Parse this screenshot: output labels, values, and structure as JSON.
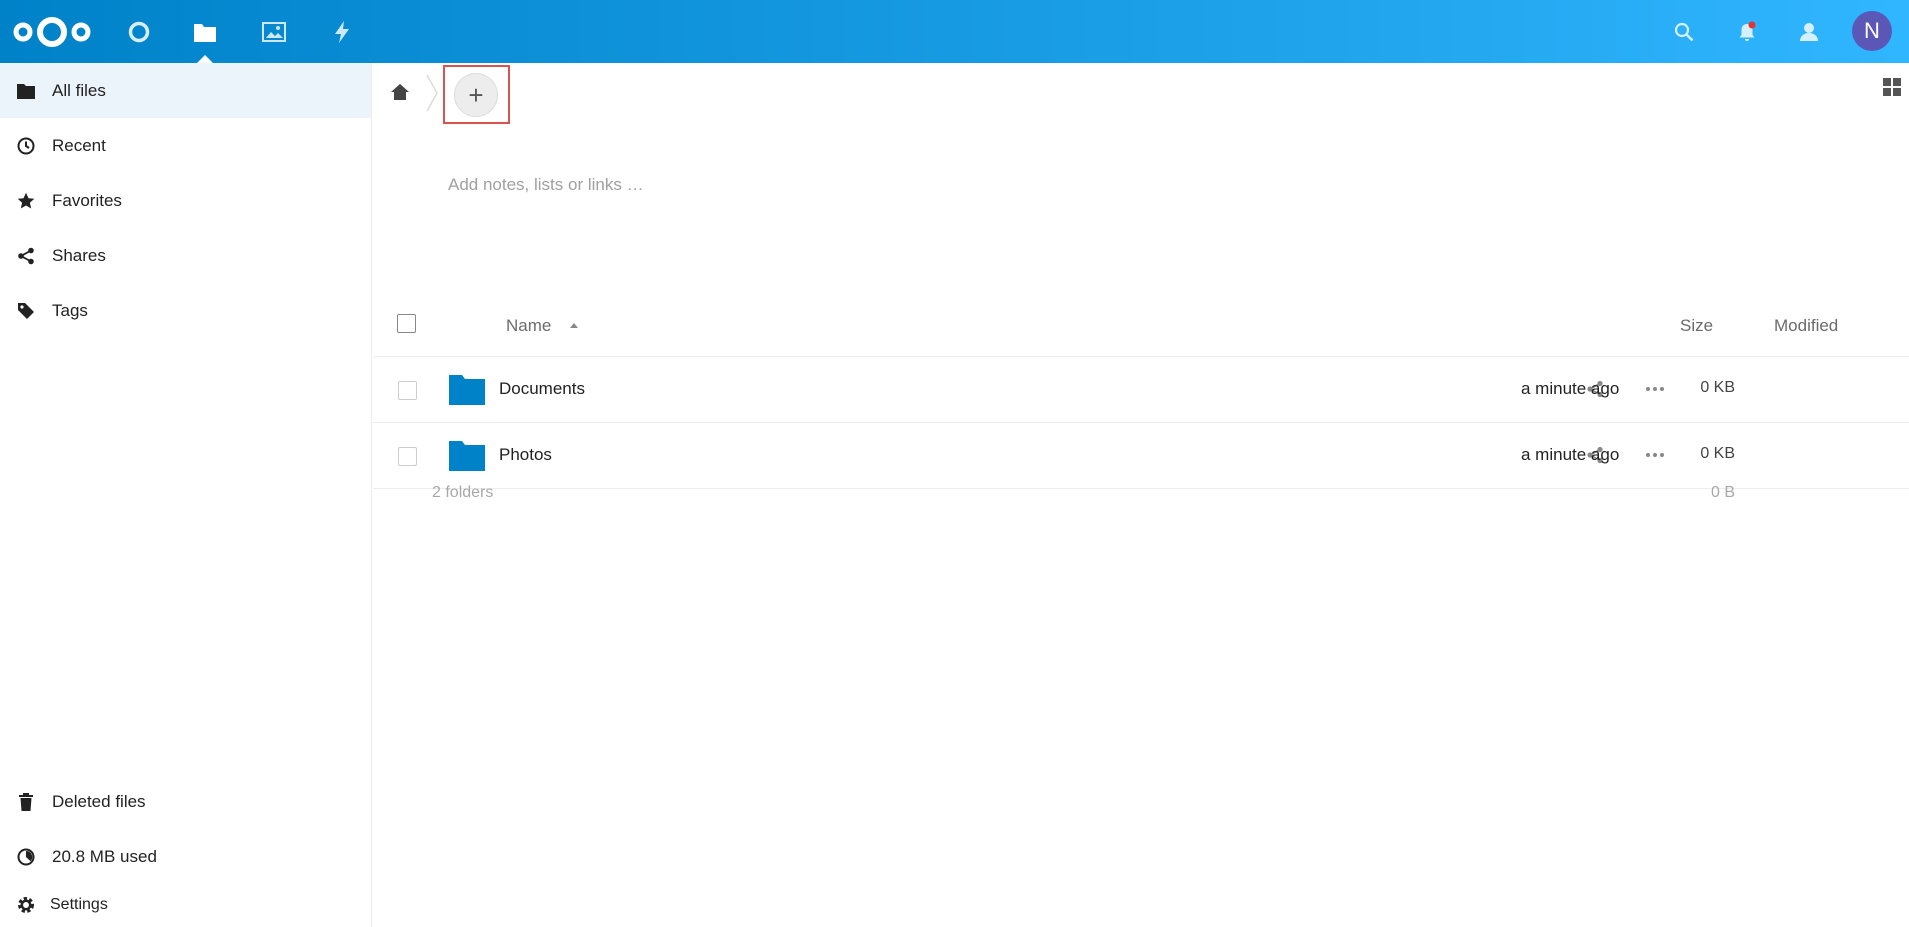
{
  "colors": {
    "header_start": "#0082c9",
    "header_end": "#30b6ff",
    "avatar": "#5b57b7",
    "folder": "#0082c9",
    "highlight_border": "#d9534f",
    "notification_dot": "#e9322d"
  },
  "header": {
    "logo_icon": "nextcloud-logo",
    "apps": [
      {
        "name": "dashboard-icon"
      },
      {
        "name": "files-icon",
        "active": true
      },
      {
        "name": "photos-icon"
      },
      {
        "name": "activity-icon"
      }
    ],
    "right_icons": [
      "search-icon",
      "notifications-icon",
      "contacts-icon"
    ],
    "avatar_letter": "N"
  },
  "sidebar": {
    "items": [
      {
        "label": "All files",
        "icon": "folder-icon",
        "active": true
      },
      {
        "label": "Recent",
        "icon": "clock-icon"
      },
      {
        "label": "Favorites",
        "icon": "star-icon"
      },
      {
        "label": "Shares",
        "icon": "share-icon"
      },
      {
        "label": "Tags",
        "icon": "tag-icon"
      }
    ],
    "bottom": {
      "deleted_label": "Deleted files",
      "quota_label": "20.8 MB used",
      "settings_label": "Settings"
    }
  },
  "main": {
    "notes_placeholder": "Add notes, lists or links …",
    "add_label": "+",
    "columns": {
      "name": "Name",
      "size": "Size",
      "modified": "Modified"
    },
    "files": [
      {
        "name": "Documents",
        "size": "0 KB",
        "modified": "a minute ago"
      },
      {
        "name": "Photos",
        "size": "0 KB",
        "modified": "a minute ago"
      }
    ],
    "summary": {
      "count": "2 folders",
      "size": "0 B"
    }
  }
}
